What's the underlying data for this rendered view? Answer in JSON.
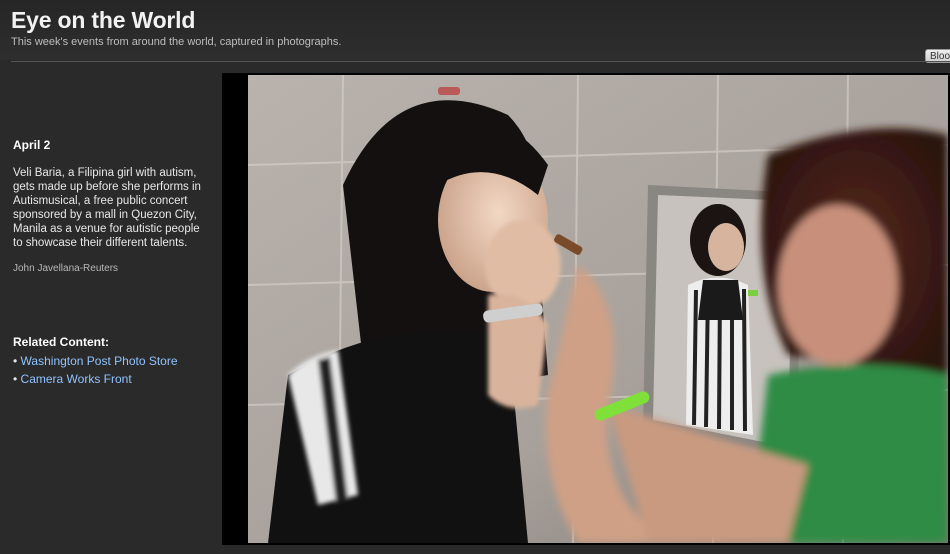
{
  "header": {
    "title": "Eye on the World",
    "subtitle": "This week's events from around the world, captured in photographs.",
    "tab_label": "Bloo"
  },
  "caption": {
    "date": "April 2",
    "description": "Veli Baria, a Filipina girl with autism, gets made up before she performs in Autismusical, a free public concert sponsored by a mall in Quezon City, Manila as a venue for autistic people to showcase their different talents.",
    "credit": "John Javellana-Reuters"
  },
  "related": {
    "heading": "Related Content:",
    "items": [
      {
        "label": "Washington Post Photo Store"
      },
      {
        "label": "Camera Works Front"
      }
    ]
  },
  "colors": {
    "background": "#2a2a2a",
    "link": "#8fc4ff",
    "heading": "#ffffff"
  }
}
